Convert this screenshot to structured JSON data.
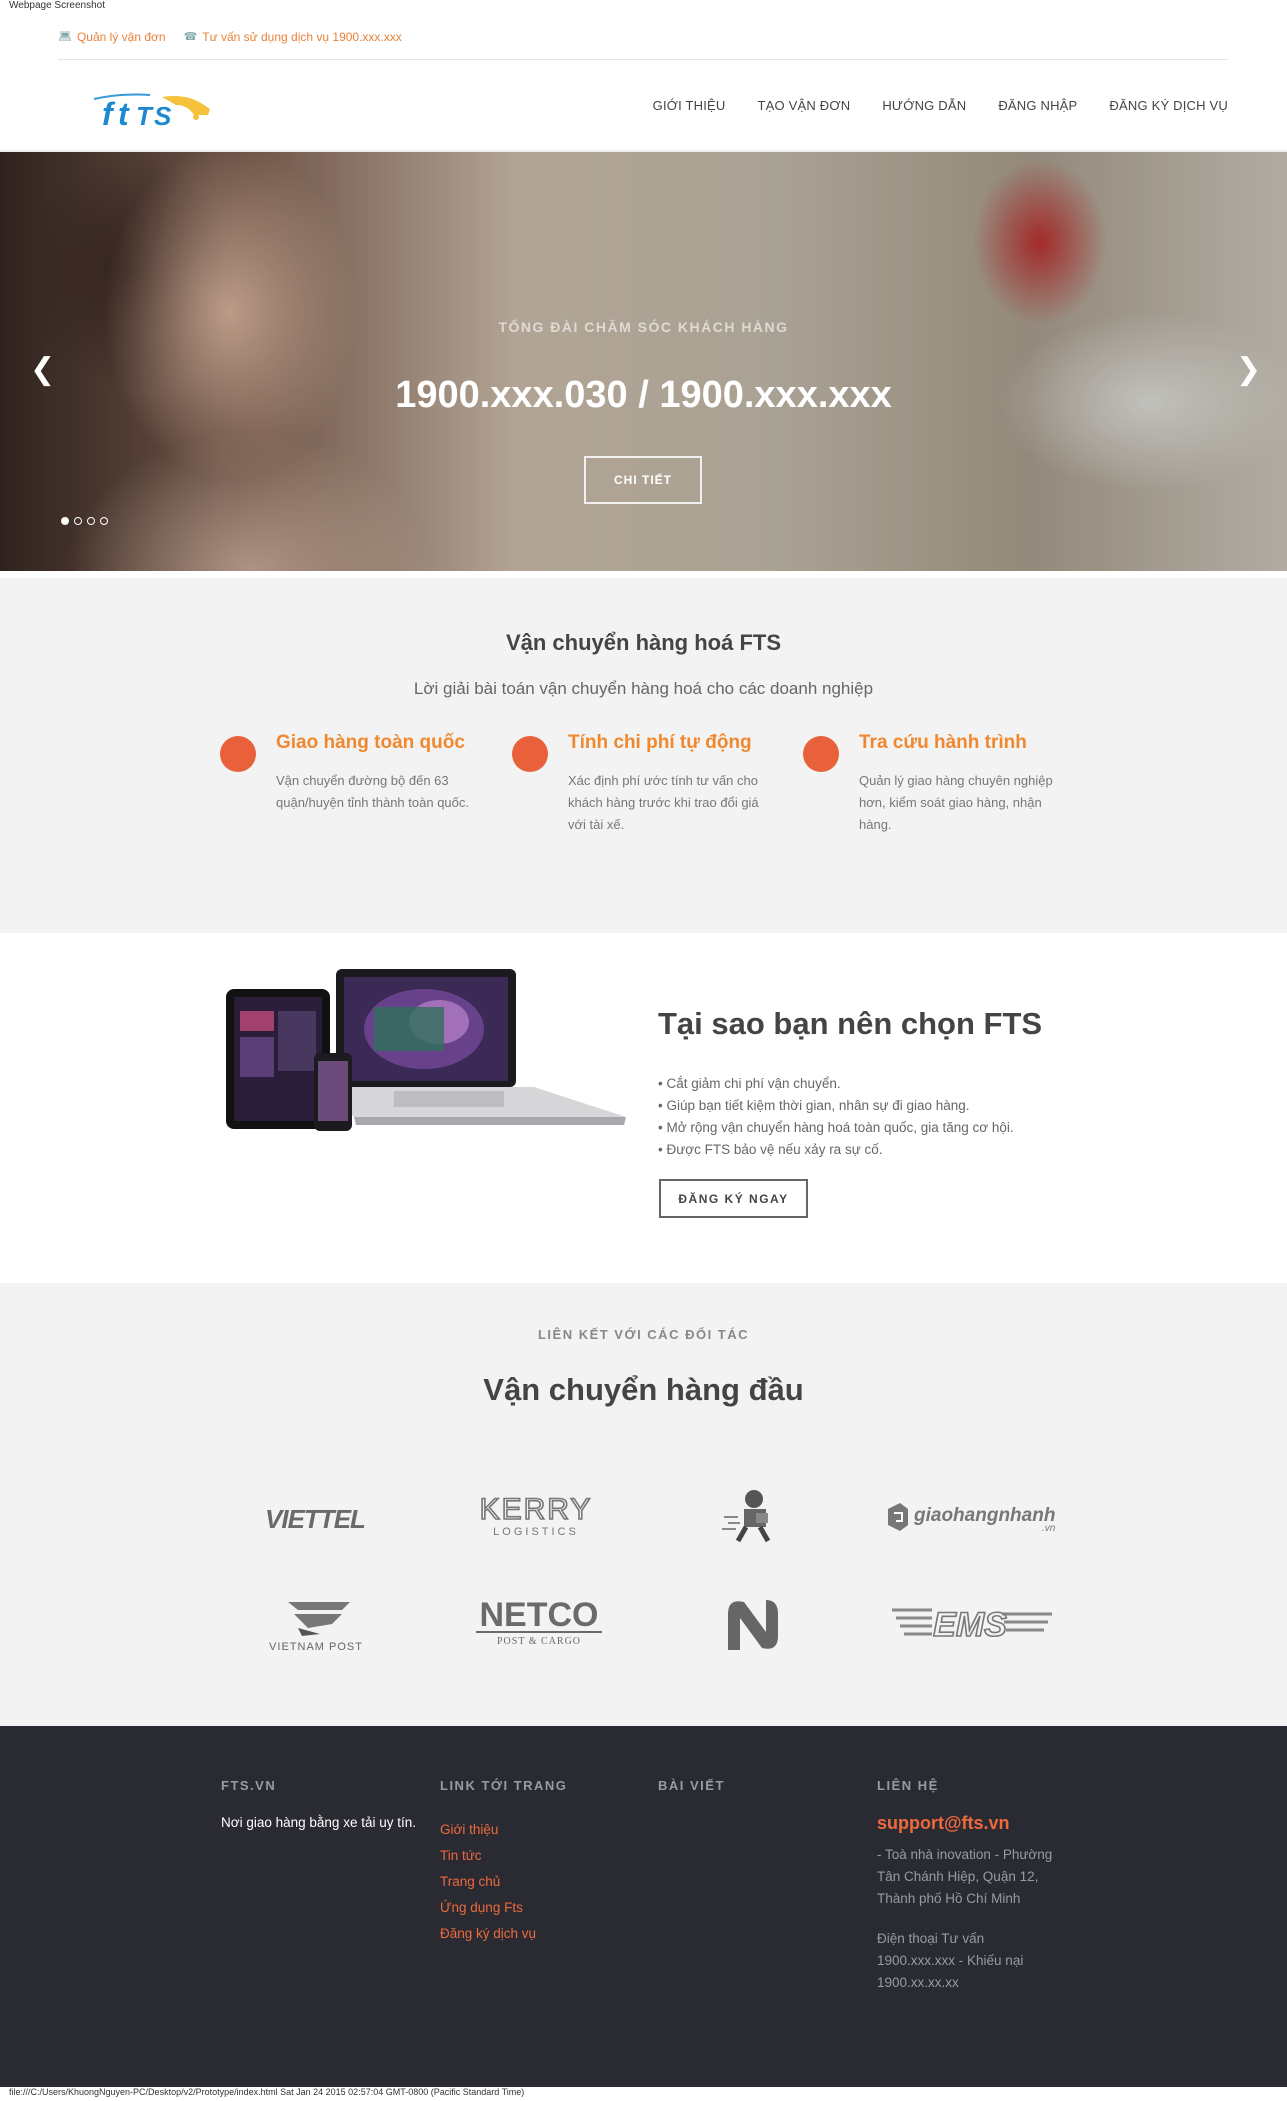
{
  "caption": {
    "top": "Webpage Screenshot",
    "bottom": "file:///C:/Users/KhuongNguyen-PC/Desktop/v2/Prototype/index.html Sat Jan 24 2015 02:57:04 GMT-0800 (Pacific Standard Time)"
  },
  "topbar": {
    "manage_label": "Quản lý vận đơn",
    "support_label": "Tư vấn sử dụng dịch vụ 1900.xxx.xxx",
    "manage_icon": "laptop-icon",
    "support_icon": "phone-icon"
  },
  "header": {
    "logo_text": "FTS",
    "nav": [
      "GIỚI THIỆU",
      "TẠO VẬN ĐƠN",
      "HƯỚNG DẪN",
      "ĐĂNG NHẬP",
      "ĐĂNG KÝ DỊCH VỤ"
    ]
  },
  "hero": {
    "kicker": "TỔNG ĐÀI CHĂM SÓC KHÁCH HÀNG",
    "title": "1900.xxx.030 / 1900.xxx.xxx",
    "button": "CHI TIẾT",
    "prev_icon": "chevron-left-icon",
    "next_icon": "chevron-right-icon",
    "slide_count": 4,
    "active_slide": 1
  },
  "services": {
    "title": "Vận chuyển hàng hoá FTS",
    "subtitle": "Lời giải bài toán vận chuyển hàng hoá cho các doanh nghiệp",
    "features": [
      {
        "title": "Giao hàng toàn quốc",
        "desc": "Vận chuyển đường bộ đến 63 quận/huyện tỉnh thành toàn quốc."
      },
      {
        "title": "Tính chi phí tự động",
        "desc": "Xác định phí ước tính tư vấn cho khách hàng trước khi trao đổi giá với tài xế."
      },
      {
        "title": "Tra cứu hành trình",
        "desc": "Quản lý giao hàng chuyên nghiệp hơn, kiểm soát giao hàng, nhận hàng."
      }
    ],
    "accent": "#e8613a",
    "title_color": "#f0882f"
  },
  "why": {
    "title": "Tại sao bạn nên chọn FTS",
    "items": [
      "Cắt giảm chi phí vận chuyển.",
      "Giúp bạn tiết kiệm thời gian, nhân sự đi giao hàng.",
      "Mở rộng vận chuyển hàng hoá toàn quốc, gia tăng cơ hội.",
      "Được FTS bảo vệ nếu xảy ra sự cố."
    ],
    "button": "ĐĂNG KÝ NGAY"
  },
  "partners": {
    "kicker": "LIÊN KẾT VỚI CÁC ĐỐI TÁC",
    "title": "Vận chuyển hàng đầu",
    "logos": [
      {
        "name": "viettel",
        "text": "VIETTEL"
      },
      {
        "name": "kerry",
        "text": "KERRY",
        "sub": "LOGISTICS"
      },
      {
        "name": "courier",
        "text": ""
      },
      {
        "name": "giaohangnhanh",
        "text": "giaohangnhanh",
        "sub": ".vn"
      },
      {
        "name": "vietnam-post",
        "text": "VIETNAM POST"
      },
      {
        "name": "netco",
        "text": "NETCO",
        "sub": "POST & CARGO"
      },
      {
        "name": "n-logo",
        "text": ""
      },
      {
        "name": "ems",
        "text": "EMS"
      }
    ]
  },
  "footer": {
    "col1": {
      "head": "FTS.VN",
      "text": "Nơi giao hàng bằng xe tải uy tín."
    },
    "col2": {
      "head": "LINK TỚI TRANG",
      "links": [
        "Giới thiệu",
        "Tin tức",
        "Trang chủ",
        "Ứng dụng Fts",
        "Đăng ký dịch vụ"
      ]
    },
    "col3": {
      "head": "BÀI VIẾT"
    },
    "col4": {
      "head": "LIÊN HỆ",
      "email": "support@fts.vn",
      "address": "- Toà nhà inovation - Phường Tân Chánh Hiệp, Quận 12, Thành phố Hồ Chí Minh",
      "phone": "Điện thoại Tư vấn 1900.xxx.xxx - Khiếu nại 1900.xx.xx.xx"
    },
    "link_color": "#ee6a3d",
    "bg": "#2a2a33"
  }
}
